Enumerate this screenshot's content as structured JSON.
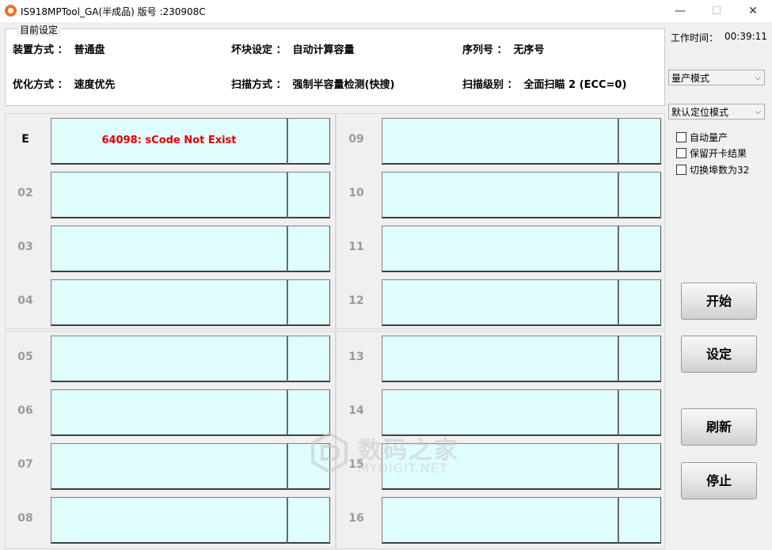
{
  "window": {
    "title": "IS918MPTool_GA(半成品) 版号 :230908C",
    "controls": {
      "minimize": "—",
      "maximize": "☐",
      "close": "✕"
    }
  },
  "settings": {
    "group_label": "目前设定",
    "mount_label": "装置方式 ：",
    "mount_value": "普通盘",
    "badblock_label": "坏块设定 ：",
    "badblock_value": "自动计算容量",
    "serial_label": "序列号 ：",
    "serial_value": "无序号",
    "optimize_label": "优化方式 ：",
    "optimize_value": "速度优先",
    "scan_label": "扫描方式 ：",
    "scan_value": "强制半容量检测(快搜)",
    "scan_level_label": "扫描级别 ：",
    "scan_level_value": "全面扫瞄 2 (ECC=0)"
  },
  "side": {
    "timer_label": "工作时间：",
    "timer_value": "00:39:11",
    "mode_select": "量产模式",
    "locate_select": "默认定位模式",
    "checkboxes": [
      {
        "label": "自动量产",
        "checked": false
      },
      {
        "label": "保留开卡结果",
        "checked": false
      },
      {
        "label": "切换埠数为32",
        "checked": false
      }
    ],
    "buttons": {
      "start": "开始",
      "settings": "设定",
      "refresh": "刷新",
      "stop": "停止"
    }
  },
  "slots": [
    {
      "label": "E",
      "message": "64098: sCode Not Exist",
      "active": true
    },
    {
      "label": "02",
      "message": ""
    },
    {
      "label": "03",
      "message": ""
    },
    {
      "label": "04",
      "message": ""
    },
    {
      "label": "05",
      "message": ""
    },
    {
      "label": "06",
      "message": ""
    },
    {
      "label": "07",
      "message": ""
    },
    {
      "label": "08",
      "message": ""
    },
    {
      "label": "09",
      "message": ""
    },
    {
      "label": "10",
      "message": ""
    },
    {
      "label": "11",
      "message": ""
    },
    {
      "label": "12",
      "message": ""
    },
    {
      "label": "13",
      "message": ""
    },
    {
      "label": "14",
      "message": ""
    },
    {
      "label": "15",
      "message": ""
    },
    {
      "label": "16",
      "message": ""
    }
  ],
  "watermark": {
    "main": "数码之家",
    "sub": "MYDIGIT.NET"
  },
  "colors": {
    "cell_bg": "#dffdfd",
    "error_text": "#e00000",
    "app_icon": "#f36f21"
  }
}
